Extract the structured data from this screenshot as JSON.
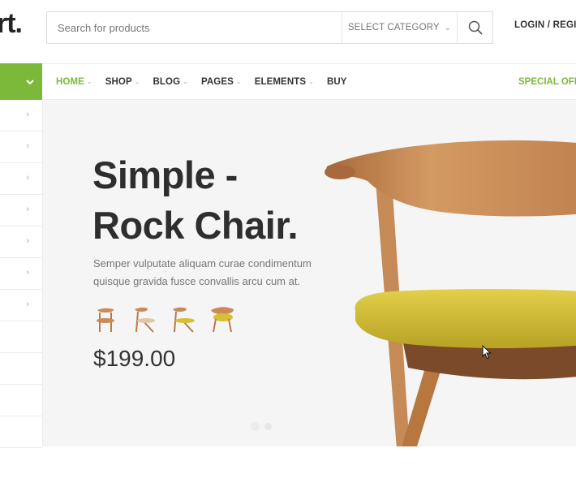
{
  "header": {
    "logo_text": "rt.",
    "search": {
      "placeholder": "Search for products",
      "category_label": "SELECT CATEGORY",
      "search_icon": "search-icon"
    },
    "login_label": "LOGIN / REGIS"
  },
  "nav": {
    "category_toggle_icon": "chevron-down-icon",
    "items": [
      {
        "label": "HOME",
        "active": true,
        "has_dropdown": true
      },
      {
        "label": "SHOP",
        "active": false,
        "has_dropdown": true
      },
      {
        "label": "BLOG",
        "active": false,
        "has_dropdown": true
      },
      {
        "label": "PAGES",
        "active": false,
        "has_dropdown": true
      },
      {
        "label": "ELEMENTS",
        "active": false,
        "has_dropdown": true
      },
      {
        "label": "BUY",
        "active": false,
        "has_dropdown": false
      }
    ],
    "special_offer": "SPECIAL OFFE"
  },
  "sidebar": {
    "rows_with_chevron": 7,
    "rows_without_chevron": 4
  },
  "hero": {
    "title_line1": "Simple -",
    "title_line2": "Rock Chair.",
    "description": "Semper vulputate aliquam curae condimentum quisque gravida fusce convallis arcu cum at.",
    "price": "$199.00",
    "thumbnails": [
      "chair-thumb-1",
      "chair-thumb-2",
      "chair-thumb-3",
      "chair-thumb-4"
    ],
    "slide_count": 2,
    "active_slide": 1
  },
  "colors": {
    "accent": "#7cb83a",
    "text_dark": "#2e2e2e",
    "hero_bg": "#f5f5f6",
    "chair_wood": "#c98a56",
    "chair_seat": "#d6bf33"
  }
}
